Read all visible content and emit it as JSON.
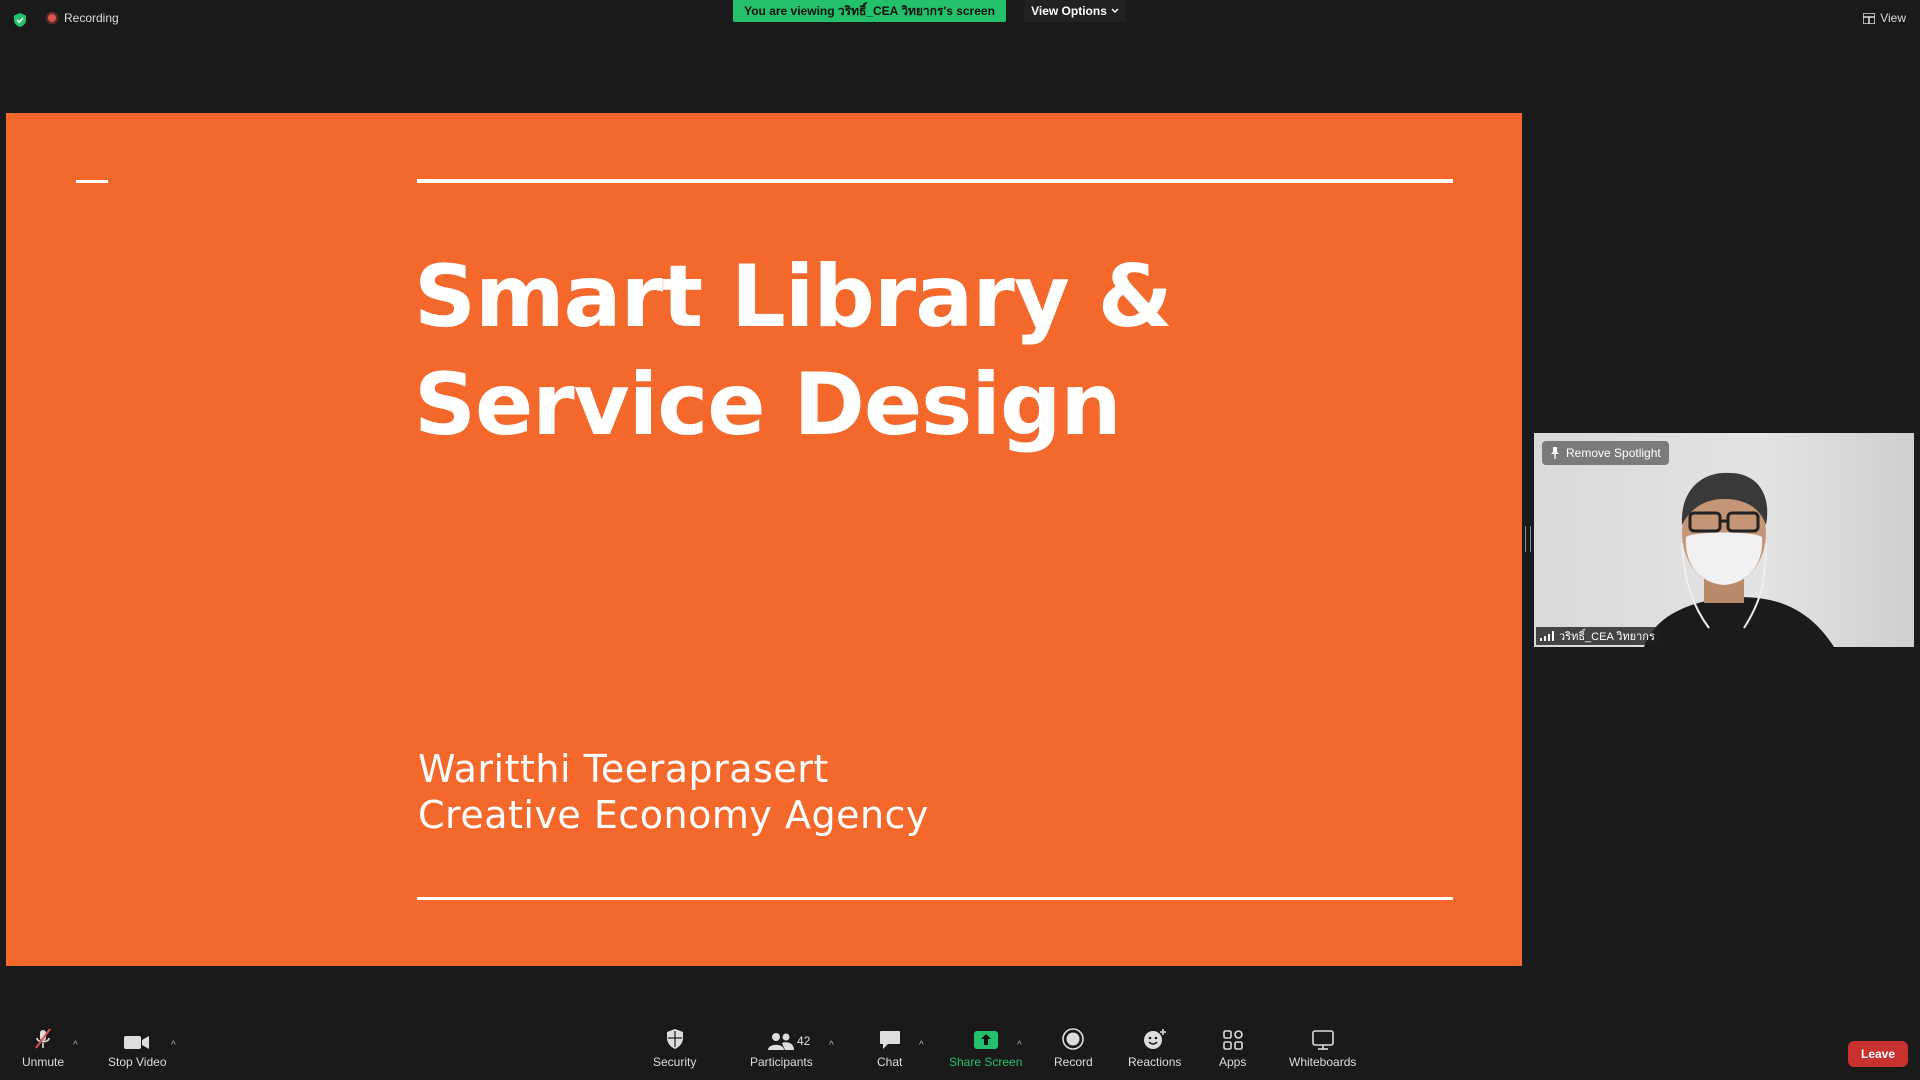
{
  "top_bar": {
    "recording_label": "Recording",
    "viewing_banner": "You are viewing วริทธิ์_CEA วิทยากร's screen",
    "view_options_label": "View Options",
    "view_label": "View"
  },
  "slide": {
    "title_line1": "Smart Library &",
    "title_line2": "Service Design",
    "author": "Waritthi Teeraprasert",
    "organization": "Creative Economy Agency",
    "background_color": "#f4692b"
  },
  "video_tile": {
    "spotlight_button": "Remove Spotlight",
    "participant_name": "วริทธิ์_CEA วิทยากร"
  },
  "toolbar": {
    "unmute_label": "Unmute",
    "stop_video_label": "Stop Video",
    "security_label": "Security",
    "participants_label": "Participants",
    "participants_count": "42",
    "chat_label": "Chat",
    "share_screen_label": "Share Screen",
    "record_label": "Record",
    "reactions_label": "Reactions",
    "apps_label": "Apps",
    "whiteboards_label": "Whiteboards",
    "leave_label": "Leave",
    "accent_color": "#23c16b",
    "leave_color": "#c8312d"
  }
}
